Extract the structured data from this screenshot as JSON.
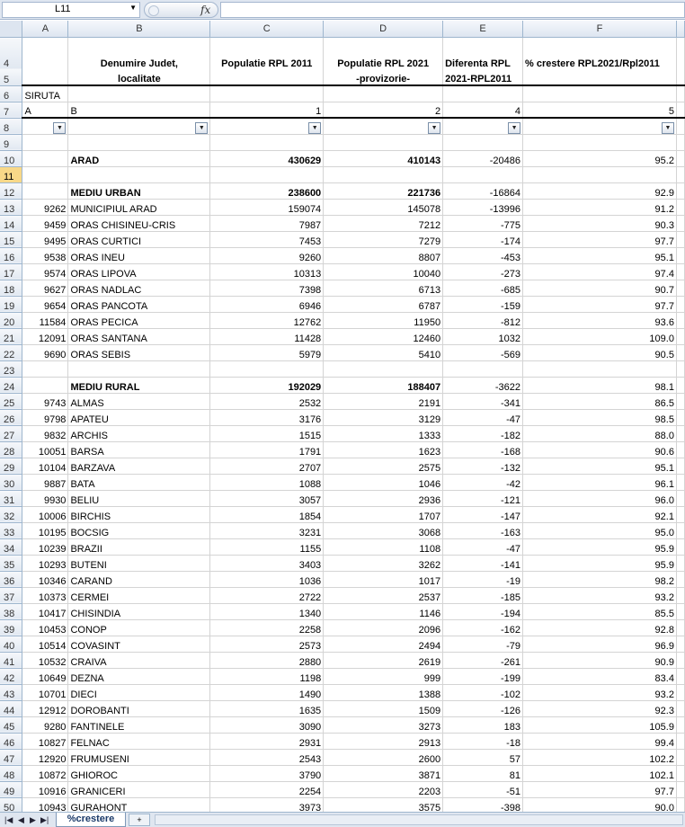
{
  "name_box": "L11",
  "fx_label": "fx",
  "columns": [
    "A",
    "B",
    "C",
    "D",
    "E",
    "F"
  ],
  "header": {
    "row4": [
      "4",
      "",
      "Denumire Judet,",
      "Populatie RPL 2011",
      "Populatie RPL 2021",
      "Diferenta  RPL",
      "% crestere RPL2021/Rpl2011"
    ],
    "row5": [
      "5",
      "",
      "localitate",
      "",
      "-provizorie-",
      "2021-RPL2011",
      ""
    ],
    "row6": [
      "6",
      "SIRUTA",
      "",
      "",
      "",
      "",
      ""
    ],
    "row7": [
      "7",
      "A",
      "B",
      "1",
      "2",
      "4",
      "5"
    ]
  },
  "filter_glyph": "▼",
  "rows": [
    [
      "9",
      "",
      "",
      "",
      "",
      "",
      ""
    ],
    [
      "10",
      "",
      "ARAD",
      "430629",
      "410143",
      "-20486",
      "95.2"
    ],
    [
      "11",
      "",
      "",
      "",
      "",
      "",
      ""
    ],
    [
      "12",
      "",
      "MEDIU URBAN",
      "238600",
      "221736",
      "-16864",
      "92.9"
    ],
    [
      "13",
      "9262",
      "MUNICIPIUL ARAD",
      "159074",
      "145078",
      "-13996",
      "91.2"
    ],
    [
      "14",
      "9459",
      "ORAS CHISINEU-CRIS",
      "7987",
      "7212",
      "-775",
      "90.3"
    ],
    [
      "15",
      "9495",
      "ORAS CURTICI",
      "7453",
      "7279",
      "-174",
      "97.7"
    ],
    [
      "16",
      "9538",
      "ORAS INEU",
      "9260",
      "8807",
      "-453",
      "95.1"
    ],
    [
      "17",
      "9574",
      "ORAS LIPOVA",
      "10313",
      "10040",
      "-273",
      "97.4"
    ],
    [
      "18",
      "9627",
      "ORAS NADLAC",
      "7398",
      "6713",
      "-685",
      "90.7"
    ],
    [
      "19",
      "9654",
      "ORAS PANCOTA",
      "6946",
      "6787",
      "-159",
      "97.7"
    ],
    [
      "20",
      "11584",
      "ORAS PECICA",
      "12762",
      "11950",
      "-812",
      "93.6"
    ],
    [
      "21",
      "12091",
      "ORAS SANTANA",
      "11428",
      "12460",
      "1032",
      "109.0"
    ],
    [
      "22",
      "9690",
      "ORAS SEBIS",
      "5979",
      "5410",
      "-569",
      "90.5"
    ],
    [
      "23",
      "",
      "",
      "",
      "",
      "",
      ""
    ],
    [
      "24",
      "",
      "MEDIU RURAL",
      "192029",
      "188407",
      "-3622",
      "98.1"
    ],
    [
      "25",
      "9743",
      "ALMAS",
      "2532",
      "2191",
      "-341",
      "86.5"
    ],
    [
      "26",
      "9798",
      "APATEU",
      "3176",
      "3129",
      "-47",
      "98.5"
    ],
    [
      "27",
      "9832",
      "ARCHIS",
      "1515",
      "1333",
      "-182",
      "88.0"
    ],
    [
      "28",
      "10051",
      "BARSA",
      "1791",
      "1623",
      "-168",
      "90.6"
    ],
    [
      "29",
      "10104",
      "BARZAVA",
      "2707",
      "2575",
      "-132",
      "95.1"
    ],
    [
      "30",
      "9887",
      "BATA",
      "1088",
      "1046",
      "-42",
      "96.1"
    ],
    [
      "31",
      "9930",
      "BELIU",
      "3057",
      "2936",
      "-121",
      "96.0"
    ],
    [
      "32",
      "10006",
      "BIRCHIS",
      "1854",
      "1707",
      "-147",
      "92.1"
    ],
    [
      "33",
      "10195",
      "BOCSIG",
      "3231",
      "3068",
      "-163",
      "95.0"
    ],
    [
      "34",
      "10239",
      "BRAZII",
      "1155",
      "1108",
      "-47",
      "95.9"
    ],
    [
      "35",
      "10293",
      "BUTENI",
      "3403",
      "3262",
      "-141",
      "95.9"
    ],
    [
      "36",
      "10346",
      "CARAND",
      "1036",
      "1017",
      "-19",
      "98.2"
    ],
    [
      "37",
      "10373",
      "CERMEI",
      "2722",
      "2537",
      "-185",
      "93.2"
    ],
    [
      "38",
      "10417",
      "CHISINDIA",
      "1340",
      "1146",
      "-194",
      "85.5"
    ],
    [
      "39",
      "10453",
      "CONOP",
      "2258",
      "2096",
      "-162",
      "92.8"
    ],
    [
      "40",
      "10514",
      "COVASINT",
      "2573",
      "2494",
      "-79",
      "96.9"
    ],
    [
      "41",
      "10532",
      "CRAIVA",
      "2880",
      "2619",
      "-261",
      "90.9"
    ],
    [
      "42",
      "10649",
      "DEZNA",
      "1198",
      "999",
      "-199",
      "83.4"
    ],
    [
      "43",
      "10701",
      "DIECI",
      "1490",
      "1388",
      "-102",
      "93.2"
    ],
    [
      "44",
      "12912",
      "DOROBANTI",
      "1635",
      "1509",
      "-126",
      "92.3"
    ],
    [
      "45",
      "9280",
      "FANTINELE",
      "3090",
      "3273",
      "183",
      "105.9"
    ],
    [
      "46",
      "10827",
      "FELNAC",
      "2931",
      "2913",
      "-18",
      "99.4"
    ],
    [
      "47",
      "12920",
      "FRUMUSENI",
      "2543",
      "2600",
      "57",
      "102.2"
    ],
    [
      "48",
      "10872",
      "GHIOROC",
      "3790",
      "3871",
      "81",
      "102.1"
    ],
    [
      "49",
      "10916",
      "GRANICERI",
      "2254",
      "2203",
      "-51",
      "97.7"
    ],
    [
      "50",
      "10943",
      "GURAHONT",
      "3973",
      "3575",
      "-398",
      "90.0"
    ]
  ],
  "sheet_tab": "%crestere",
  "selected_row": "11"
}
